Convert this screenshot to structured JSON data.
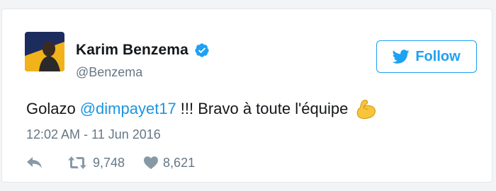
{
  "user": {
    "name": "Karim Benzema",
    "handle": "@Benzema",
    "verified": true
  },
  "follow_button": {
    "label": "Follow"
  },
  "tweet": {
    "text_before": "Golazo",
    "mention": "@dimpayet17",
    "text_after": "!!! Bravo à toute l'équipe",
    "emoji": "flexed-biceps",
    "timestamp": "12:02 AM - 11 Jun 2016"
  },
  "actions": {
    "retweets": "9,748",
    "likes": "8,621"
  },
  "colors": {
    "accent": "#1da1f2",
    "mention": "#1b95e0",
    "muted": "#657786",
    "text": "#14171a"
  }
}
